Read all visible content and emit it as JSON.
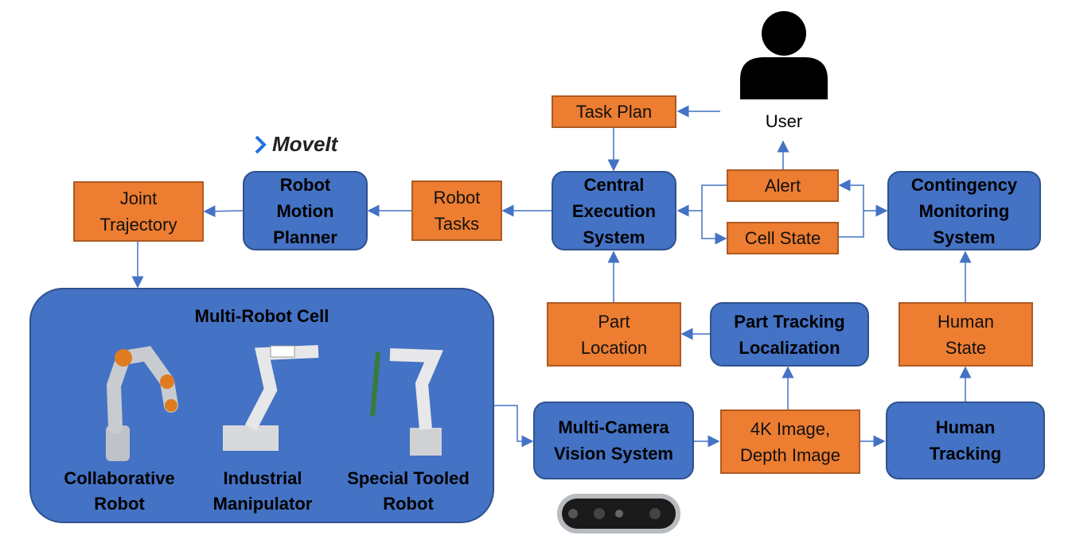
{
  "colors": {
    "process": "#4472c4",
    "data": "#ed7d31",
    "arrow": "#4472c4"
  },
  "logo": {
    "text": "MoveIt"
  },
  "user": {
    "label": "User",
    "icon": "person-icon"
  },
  "nodes": {
    "task_plan": "Task Plan",
    "central": "Central\nExecution\nSystem",
    "alert": "Alert",
    "cell_state": "Cell State",
    "contingency": "Contingency\nMonitoring\nSystem",
    "robot_tasks": "Robot\nTasks",
    "motion_planner": "Robot\nMotion\nPlanner",
    "joint_trajectory": "Joint\nTrajectory",
    "part_location": "Part\nLocation",
    "part_tracking": "Part Tracking\nLocalization",
    "human_state": "Human\nState",
    "multi_camera": "Multi-Camera\nVision System",
    "images": "4K Image,\nDepth Image",
    "human_tracking": "Human\nTracking"
  },
  "cell": {
    "title": "Multi-Robot Cell",
    "robots": [
      "Collaborative\nRobot",
      "Industrial\nManipulator",
      "Special Tooled\nRobot"
    ]
  }
}
